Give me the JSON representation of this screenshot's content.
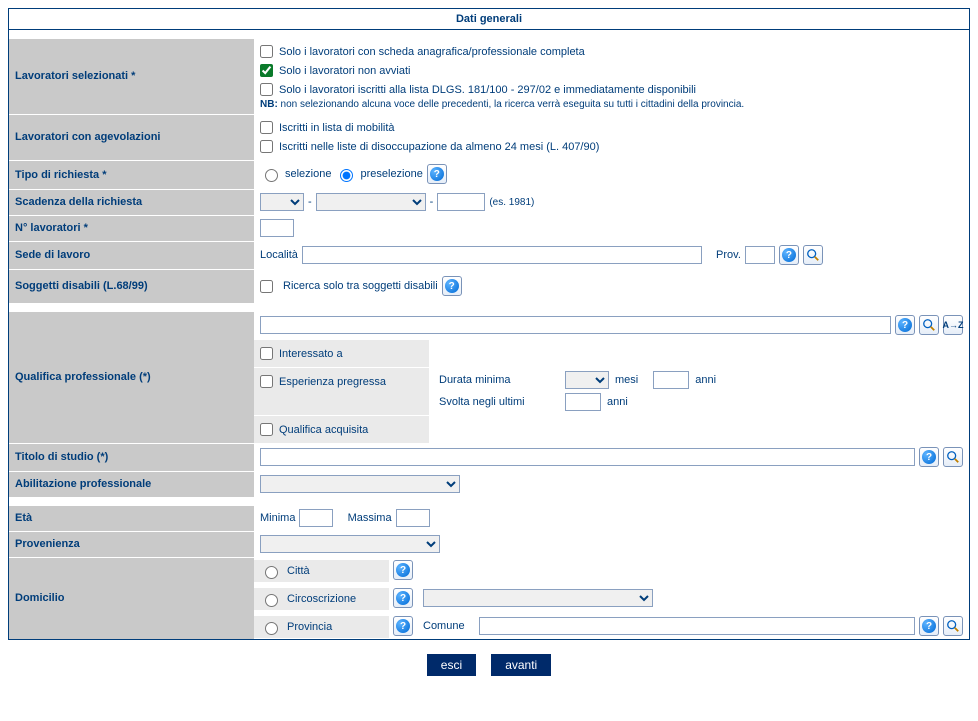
{
  "title": "Dati generali",
  "lavoratori_selezionati": {
    "label": "Lavoratori selezionati *",
    "opt1": "Solo i lavoratori con scheda anagrafica/professionale completa",
    "opt2": "Solo i lavoratori non avviati",
    "opt3": "Solo i lavoratori iscritti alla lista DLGS. 181/100 - 297/02 e immediatamente disponibili",
    "note_prefix": "NB:",
    "note": " non selezionando alcuna voce delle precedenti, la ricerca verrà eseguita su tutti i cittadini della provincia."
  },
  "agevolazioni": {
    "label": "Lavoratori con agevolazioni",
    "opt1": "Iscritti in lista di mobilità",
    "opt2": "Iscritti nelle liste di disoccupazione da almeno 24 mesi (L. 407/90)"
  },
  "tipo_richiesta": {
    "label": "Tipo di richiesta *",
    "r1": "selezione",
    "r2": "preselezione"
  },
  "scadenza": {
    "label": "Scadenza della richiesta",
    "hint": "(es. 1981)"
  },
  "n_lavoratori": {
    "label": "N° lavoratori *"
  },
  "sede": {
    "label": "Sede di lavoro",
    "localita": "Località",
    "prov": "Prov."
  },
  "disabili": {
    "label": "Soggetti disabili (L.68/99)",
    "opt": "Ricerca solo tra soggetti disabili"
  },
  "qualifica": {
    "label": "Qualifica professionale (*)",
    "interessato": "Interessato a",
    "esperienza": "Esperienza pregressa",
    "durata_min": "Durata minima",
    "mesi": "mesi",
    "anni": "anni",
    "svolta": "Svolta negli ultimi",
    "acquisita": "Qualifica acquisita"
  },
  "titolo": {
    "label": "Titolo di studio (*)"
  },
  "abilitazione": {
    "label": "Abilitazione professionale"
  },
  "eta": {
    "label": "Età",
    "min": "Minima",
    "max": "Massima"
  },
  "provenienza": {
    "label": "Provenienza"
  },
  "domicilio": {
    "label": "Domicilio",
    "citta": "Città",
    "circo": "Circoscrizione",
    "prov": "Provincia",
    "comune": "Comune"
  },
  "buttons": {
    "esci": "esci",
    "avanti": "avanti"
  }
}
